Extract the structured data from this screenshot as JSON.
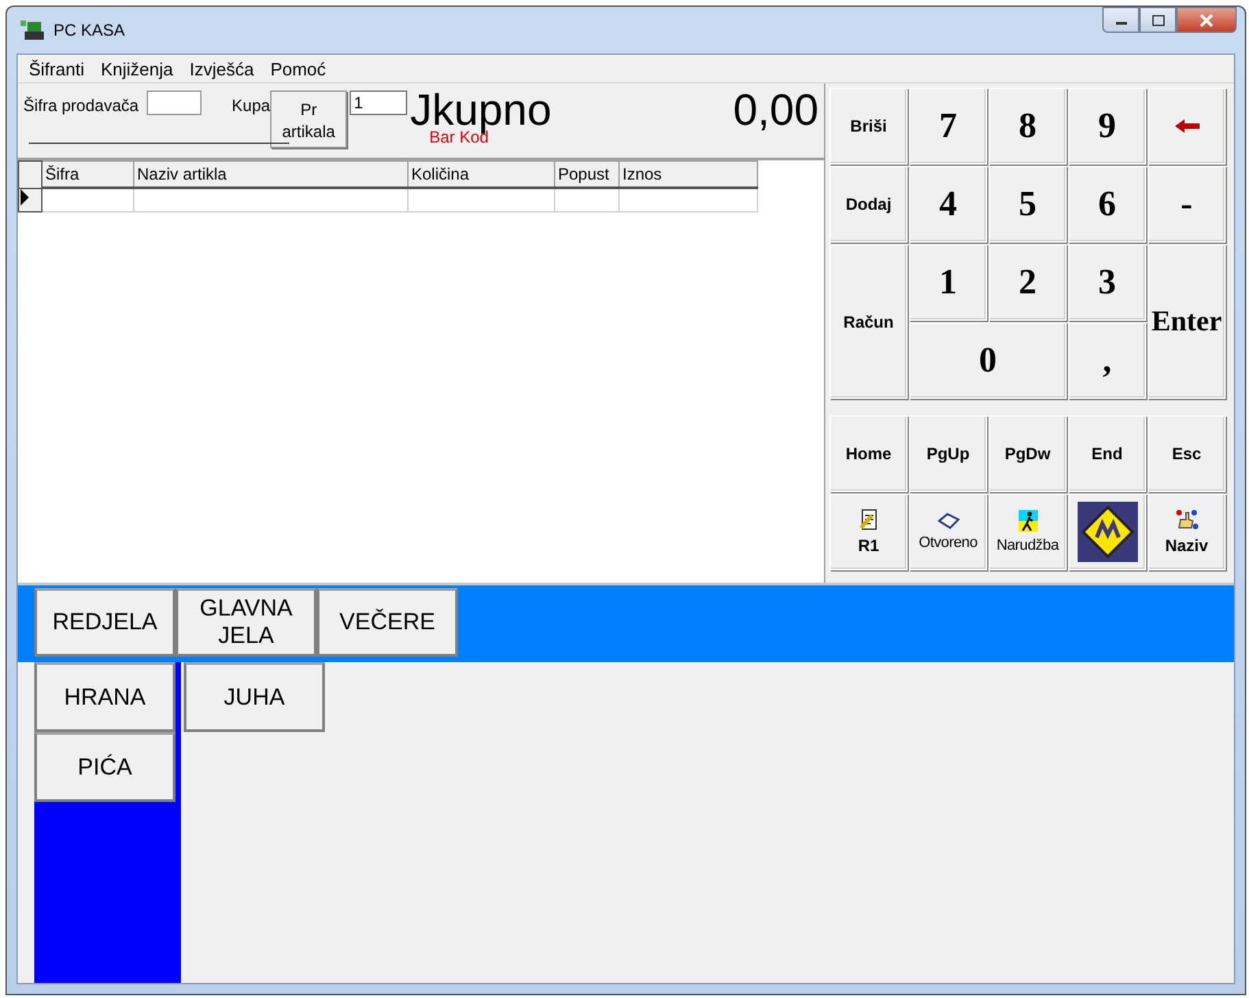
{
  "window": {
    "title": "PC KASA"
  },
  "menu": [
    "Šifranti",
    "Knjiženja",
    "Izvješća",
    "Pomoć"
  ],
  "header": {
    "seller_label": "Šifra prodavača",
    "buyer_label": "Kupa",
    "quantity_button": {
      "line_1": "Pr",
      "line_2": "artikala"
    },
    "quantity_value": "1",
    "total_label": "Jkupno",
    "barcode_label": "Bar Kod",
    "total": "0,00"
  },
  "table": {
    "columns": [
      "Šifra",
      "Naziv artikla",
      "Količina",
      "Popust",
      "Iznos"
    ],
    "rows": [
      {
        "current": true,
        "cells": [
          "",
          "",
          "",
          "",
          ""
        ]
      }
    ]
  },
  "keypad": [
    {
      "kind": "command",
      "label": "Briši"
    },
    {
      "kind": "digit",
      "label": "7"
    },
    {
      "kind": "digit",
      "label": "8"
    },
    {
      "kind": "digit",
      "label": "9"
    },
    {
      "kind": "arrow"
    },
    {
      "kind": "command",
      "label": "Dodaj"
    },
    {
      "kind": "digit",
      "label": "4"
    },
    {
      "kind": "digit",
      "label": "5"
    },
    {
      "kind": "digit",
      "label": "6"
    },
    {
      "kind": "digit",
      "label": "-"
    },
    {
      "kind": "command",
      "label": "Račun"
    },
    {
      "kind": "digit",
      "label": "1"
    },
    {
      "kind": "digit",
      "label": "2"
    },
    {
      "kind": "digit",
      "label": "3"
    },
    {
      "kind": "enter",
      "label": "Enter"
    },
    {
      "kind": "digit",
      "label": "0"
    },
    {
      "kind": "digit",
      "label": ","
    }
  ],
  "nav_keys": [
    "Home",
    "PgUp",
    "PgDw",
    "End",
    "Esc"
  ],
  "function_keys": [
    {
      "kind": "document",
      "label": "R1"
    },
    {
      "kind": "book",
      "label": "Otvoreno"
    },
    {
      "kind": "walker",
      "label": "Narudžba"
    },
    {
      "kind": "logo"
    },
    {
      "kind": "hand",
      "label": "Naziv"
    }
  ],
  "categories": [
    "REDJELA",
    "GLAVNA JELA",
    "VEČERE"
  ],
  "groups": [
    "HRANA",
    "PIĆA"
  ],
  "items": [
    "JUHA"
  ]
}
